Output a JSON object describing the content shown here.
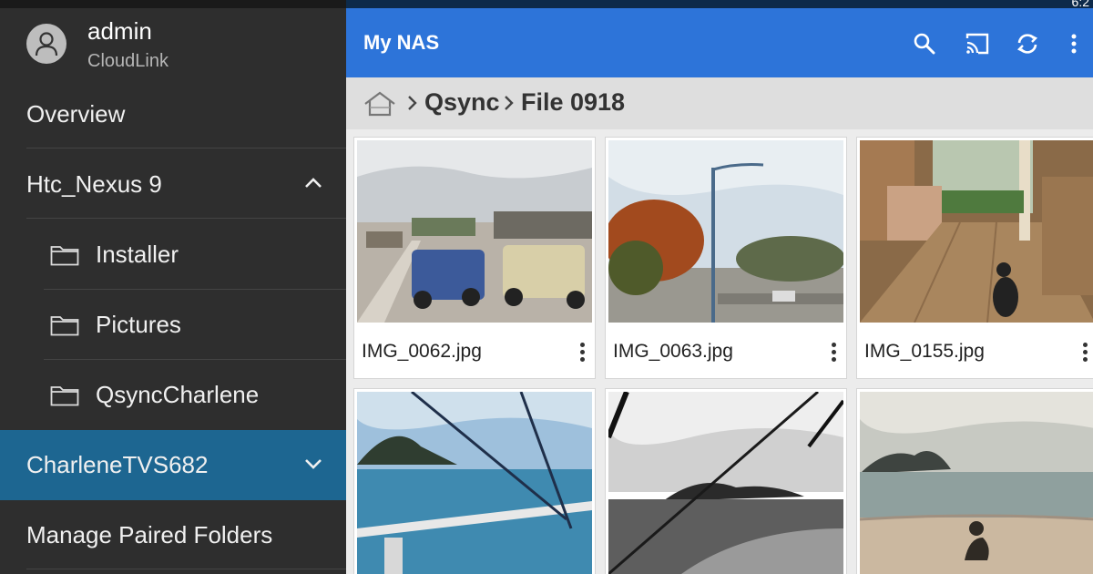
{
  "statusbar": {
    "clock": "6:2"
  },
  "drawer": {
    "user": {
      "name": "admin",
      "server": "CloudLink"
    },
    "items": [
      {
        "label": "Overview"
      },
      {
        "label": "Htc_Nexus 9"
      },
      {
        "label": "Installer"
      },
      {
        "label": "Pictures"
      },
      {
        "label": "QsyncCharlene"
      },
      {
        "label": "CharleneTVS682"
      },
      {
        "label": "Manage Paired Folders"
      }
    ]
  },
  "appbar": {
    "title": "My NAS",
    "icons": [
      "search-icon",
      "cast-icon",
      "refresh-icon",
      "more-vert-icon"
    ]
  },
  "breadcrumb": {
    "items": [
      "Qsync",
      "File 0918"
    ]
  },
  "files": [
    {
      "name": "IMG_0062.jpg"
    },
    {
      "name": "IMG_0063.jpg"
    },
    {
      "name": "IMG_0155.jpg"
    },
    {
      "name": ""
    },
    {
      "name": ""
    },
    {
      "name": ""
    }
  ],
  "colors": {
    "appbar": "#2d74d9",
    "drawer": "#2e2e2e",
    "selected": "#1d6691"
  }
}
